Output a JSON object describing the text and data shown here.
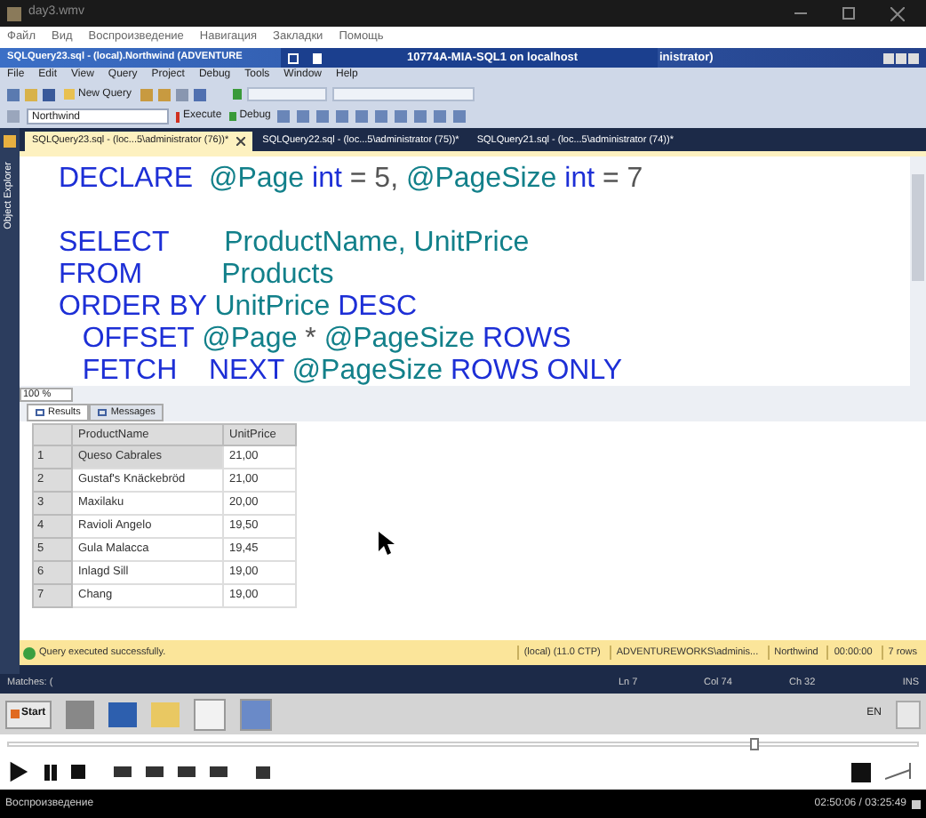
{
  "player": {
    "title": "day3.wmv",
    "menu": [
      "Файл",
      "Вид",
      "Воспроизведение",
      "Навигация",
      "Закладки",
      "Помощь"
    ],
    "seek": {
      "level": 0.82
    },
    "status": "Воспроизведение",
    "time": "02:50:06 / 03:25:49"
  },
  "ssms": {
    "title": "SQLQuery23.sql - (local).Northwind (ADVENTURE",
    "rdp_title": "10774A-MIA-SQL1 on localhost",
    "title_tail": "inistrator)",
    "menu": [
      "File",
      "Edit",
      "View",
      "Query",
      "Project",
      "Debug",
      "Tools",
      "Window",
      "Help"
    ],
    "new_query": "New Query",
    "database": "Northwind",
    "execute": "Execute",
    "debug": "Debug",
    "side_panel": "Object Explorer",
    "tabs": [
      {
        "label": "SQLQuery23.sql - (loc...5\\administrator (76))*",
        "selected": true
      },
      {
        "label": "SQLQuery22.sql - (loc...5\\administrator (75))*",
        "selected": false
      },
      {
        "label": "SQLQuery21.sql - (loc...5\\administrator (74))*",
        "selected": false
      }
    ],
    "code": [
      [
        {
          "kind": "keyword",
          "text": "DECLARE  "
        },
        {
          "kind": "ident",
          "text": "@Page "
        },
        {
          "kind": "keyword",
          "text": "int "
        },
        {
          "kind": "plain",
          "text": "= 5, "
        },
        {
          "kind": "ident",
          "text": "@PageSize "
        },
        {
          "kind": "keyword",
          "text": "int "
        },
        {
          "kind": "plain",
          "text": "= 7"
        }
      ],
      [
        {
          "kind": "keyword",
          "text": "SELECT       ",
          "blank_before": true
        },
        {
          "kind": "ident",
          "text": "ProductName, UnitPrice"
        }
      ],
      [
        {
          "kind": "keyword",
          "text": "FROM          "
        },
        {
          "kind": "ident",
          "text": "Products"
        }
      ],
      [
        {
          "kind": "keyword",
          "text": "ORDER BY "
        },
        {
          "kind": "ident",
          "text": "UnitPrice "
        },
        {
          "kind": "keyword",
          "text": "DESC"
        }
      ],
      [
        {
          "kind": "keyword",
          "text": "   OFFSET "
        },
        {
          "kind": "ident",
          "text": "@Page "
        },
        {
          "kind": "plain",
          "text": "* "
        },
        {
          "kind": "ident",
          "text": "@PageSize "
        },
        {
          "kind": "keyword",
          "text": "ROWS"
        }
      ],
      [
        {
          "kind": "keyword",
          "text": "   FETCH    NEXT "
        },
        {
          "kind": "ident",
          "text": "@PageSize "
        },
        {
          "kind": "keyword",
          "text": "ROWS ONLY"
        }
      ]
    ],
    "zoom": "100 %",
    "result_tabs": [
      {
        "label": "Results",
        "selected": true
      },
      {
        "label": "Messages",
        "selected": false
      }
    ],
    "grid": {
      "columns": [
        "ProductName",
        "UnitPrice"
      ],
      "rows": [
        {
          "num": "1",
          "cells": [
            "Queso Cabrales",
            "21,00"
          ],
          "selected": true
        },
        {
          "num": "2",
          "cells": [
            "Gustaf's Knäckebröd",
            "21,00"
          ],
          "selected": false
        },
        {
          "num": "3",
          "cells": [
            "Maxilaku",
            "20,00"
          ],
          "selected": false
        },
        {
          "num": "4",
          "cells": [
            "Ravioli Angelo",
            "19,50"
          ],
          "selected": false
        },
        {
          "num": "5",
          "cells": [
            "Gula Malacca",
            "19,45"
          ],
          "selected": false
        },
        {
          "num": "6",
          "cells": [
            "Inlagd Sill",
            "19,00"
          ],
          "selected": false
        },
        {
          "num": "7",
          "cells": [
            "Chang",
            "19,00"
          ],
          "selected": false
        }
      ]
    },
    "query_status": "Query executed successfully.",
    "query_info": [
      "(local) (11.0 CTP)",
      "ADVENTUREWORKS\\adminis...",
      "Northwind",
      "00:00:00",
      "7 rows"
    ],
    "status_bar": {
      "left": "Matches: (",
      "items": [
        "Ln 7",
        "Col 74",
        "Ch 32",
        "INS"
      ]
    }
  },
  "taskbar": {
    "start": "Start",
    "language": "EN"
  }
}
